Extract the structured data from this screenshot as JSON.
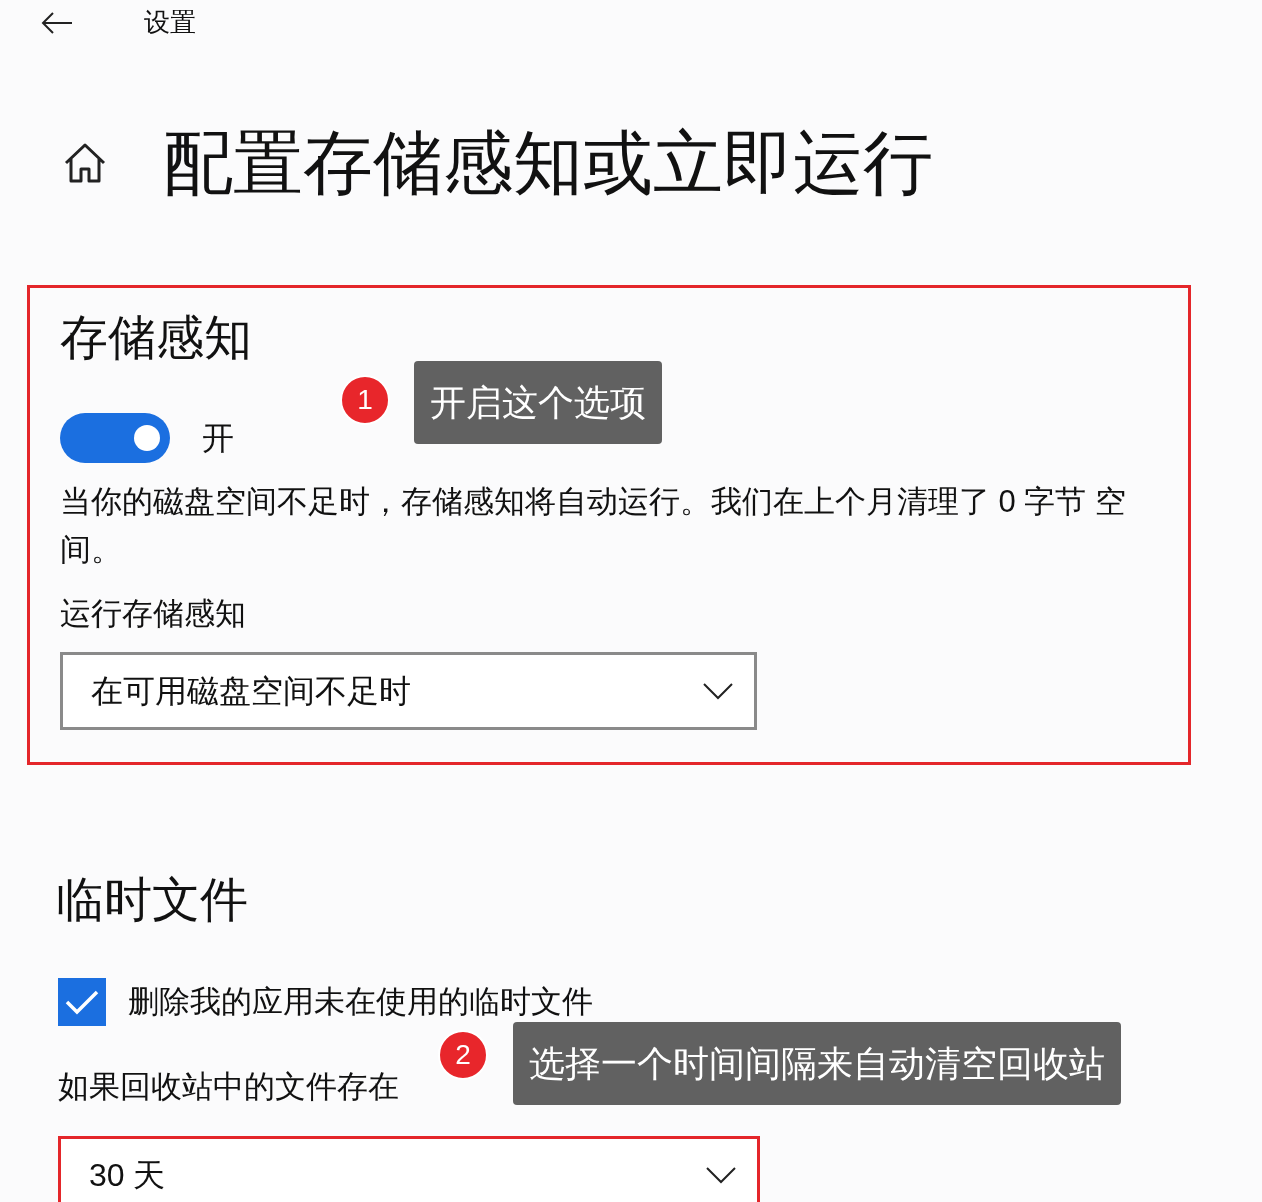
{
  "header": {
    "title": "设置"
  },
  "page_title": "配置存储感知或立即运行",
  "storage_sense": {
    "title": "存储感知",
    "highlighted": true,
    "toggle": {
      "on": true,
      "label": "开"
    },
    "description": "当你的磁盘空间不足时，存储感知将自动运行。我们在上个月清理了 0 字节 空间。",
    "run_label": "运行存储感知",
    "run_select": {
      "value": "在可用磁盘空间不足时",
      "highlighted": false
    }
  },
  "temp_files": {
    "title": "临时文件",
    "checkbox": {
      "checked": true,
      "label": "删除我的应用未在使用的临时文件"
    },
    "recycle_label": "如果回收站中的文件存在",
    "recycle_select": {
      "value": "30 天",
      "highlighted": true
    }
  },
  "annotations": [
    {
      "number": "1",
      "text": "开启这个选项"
    },
    {
      "number": "2",
      "text": "选择一个时间间隔来自动清空回收站"
    }
  ]
}
